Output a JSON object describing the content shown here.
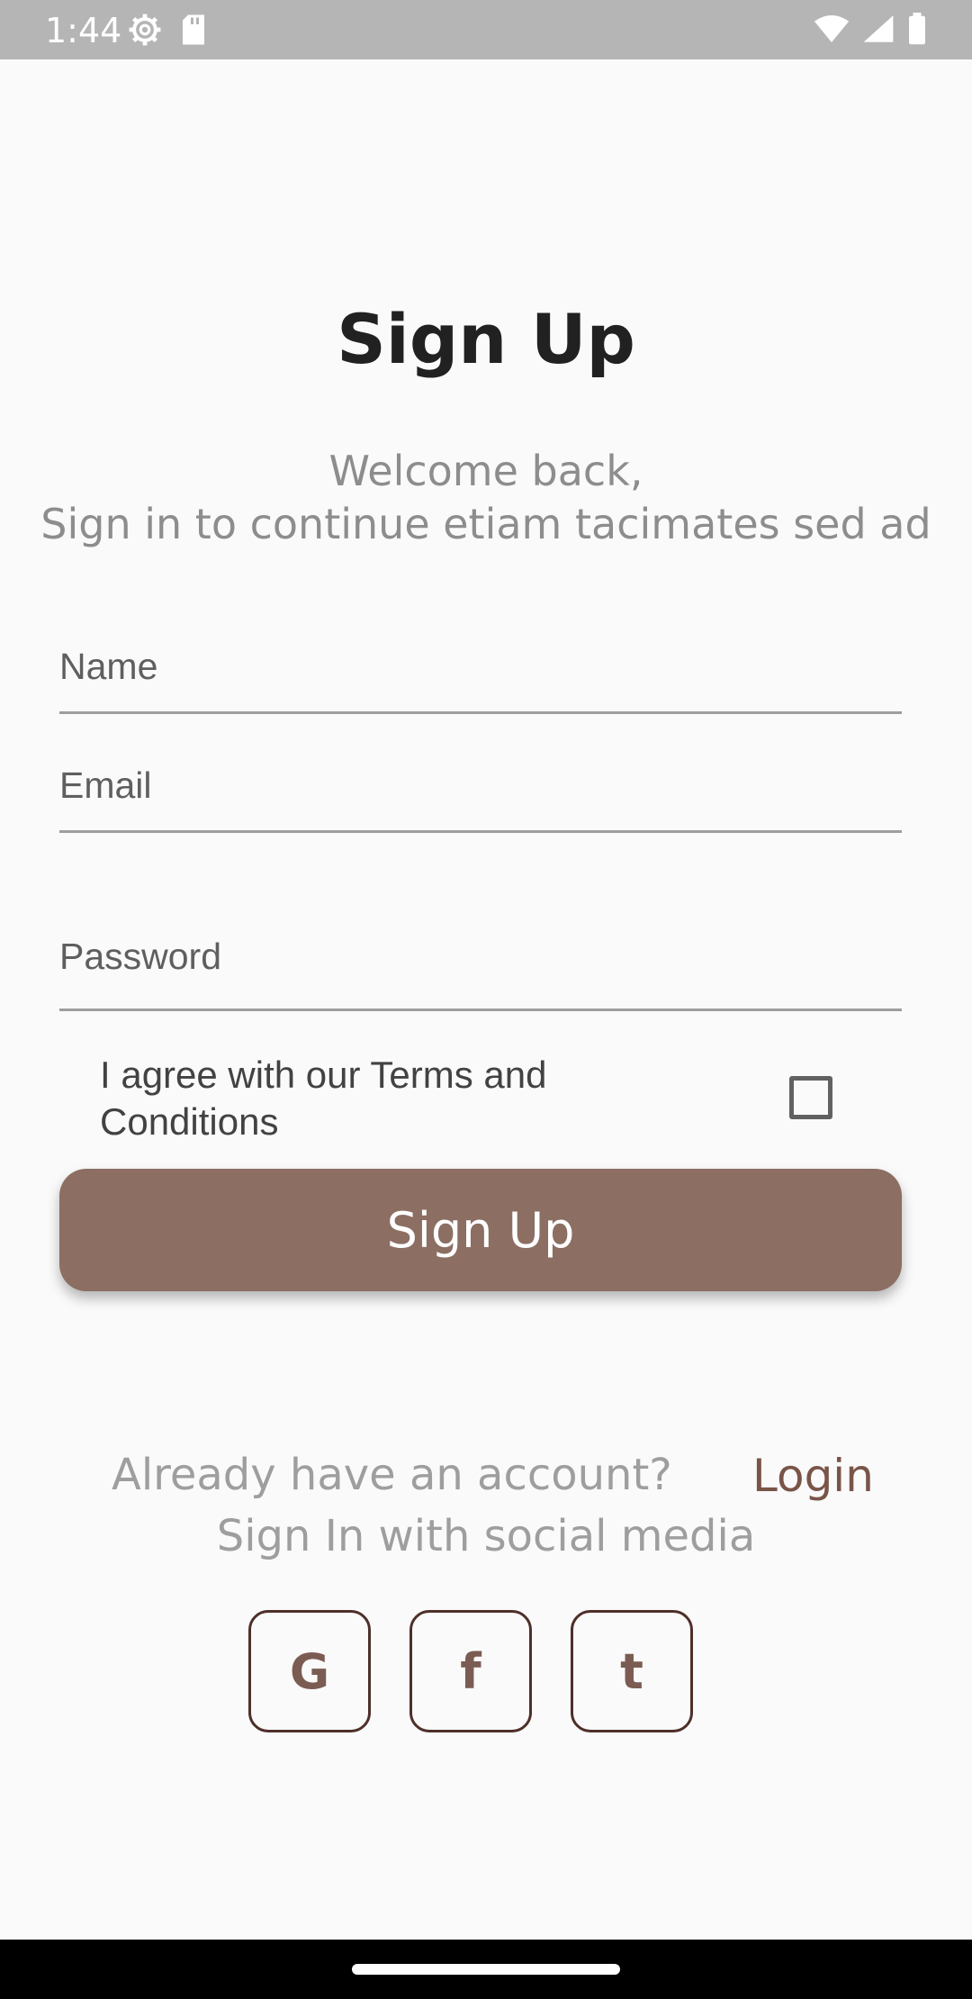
{
  "status_bar": {
    "time": "1:44",
    "left_icons": [
      "gear-icon",
      "sd-card-icon"
    ],
    "right_icons": [
      "wifi-icon",
      "signal-icon",
      "battery-icon"
    ]
  },
  "title": "Sign Up",
  "subtitle_line1": "Welcome back,",
  "subtitle_line2": "Sign in to continue etiam tacimates sed ad",
  "fields": {
    "name_placeholder": "Name",
    "email_placeholder": "Email",
    "password_placeholder": "Password"
  },
  "terms": {
    "label": "I agree with our Terms and Conditions",
    "checked": false
  },
  "signup_button": "Sign Up",
  "account_prompt": "Already have an account?",
  "login_link": "Login",
  "social_prompt": "Sign In with social media",
  "social_buttons": {
    "google": "G",
    "facebook": "f",
    "twitter": "t"
  },
  "colors": {
    "accent": "#8c6e63",
    "link": "#795548",
    "status_bar": "#b5b5b5"
  }
}
